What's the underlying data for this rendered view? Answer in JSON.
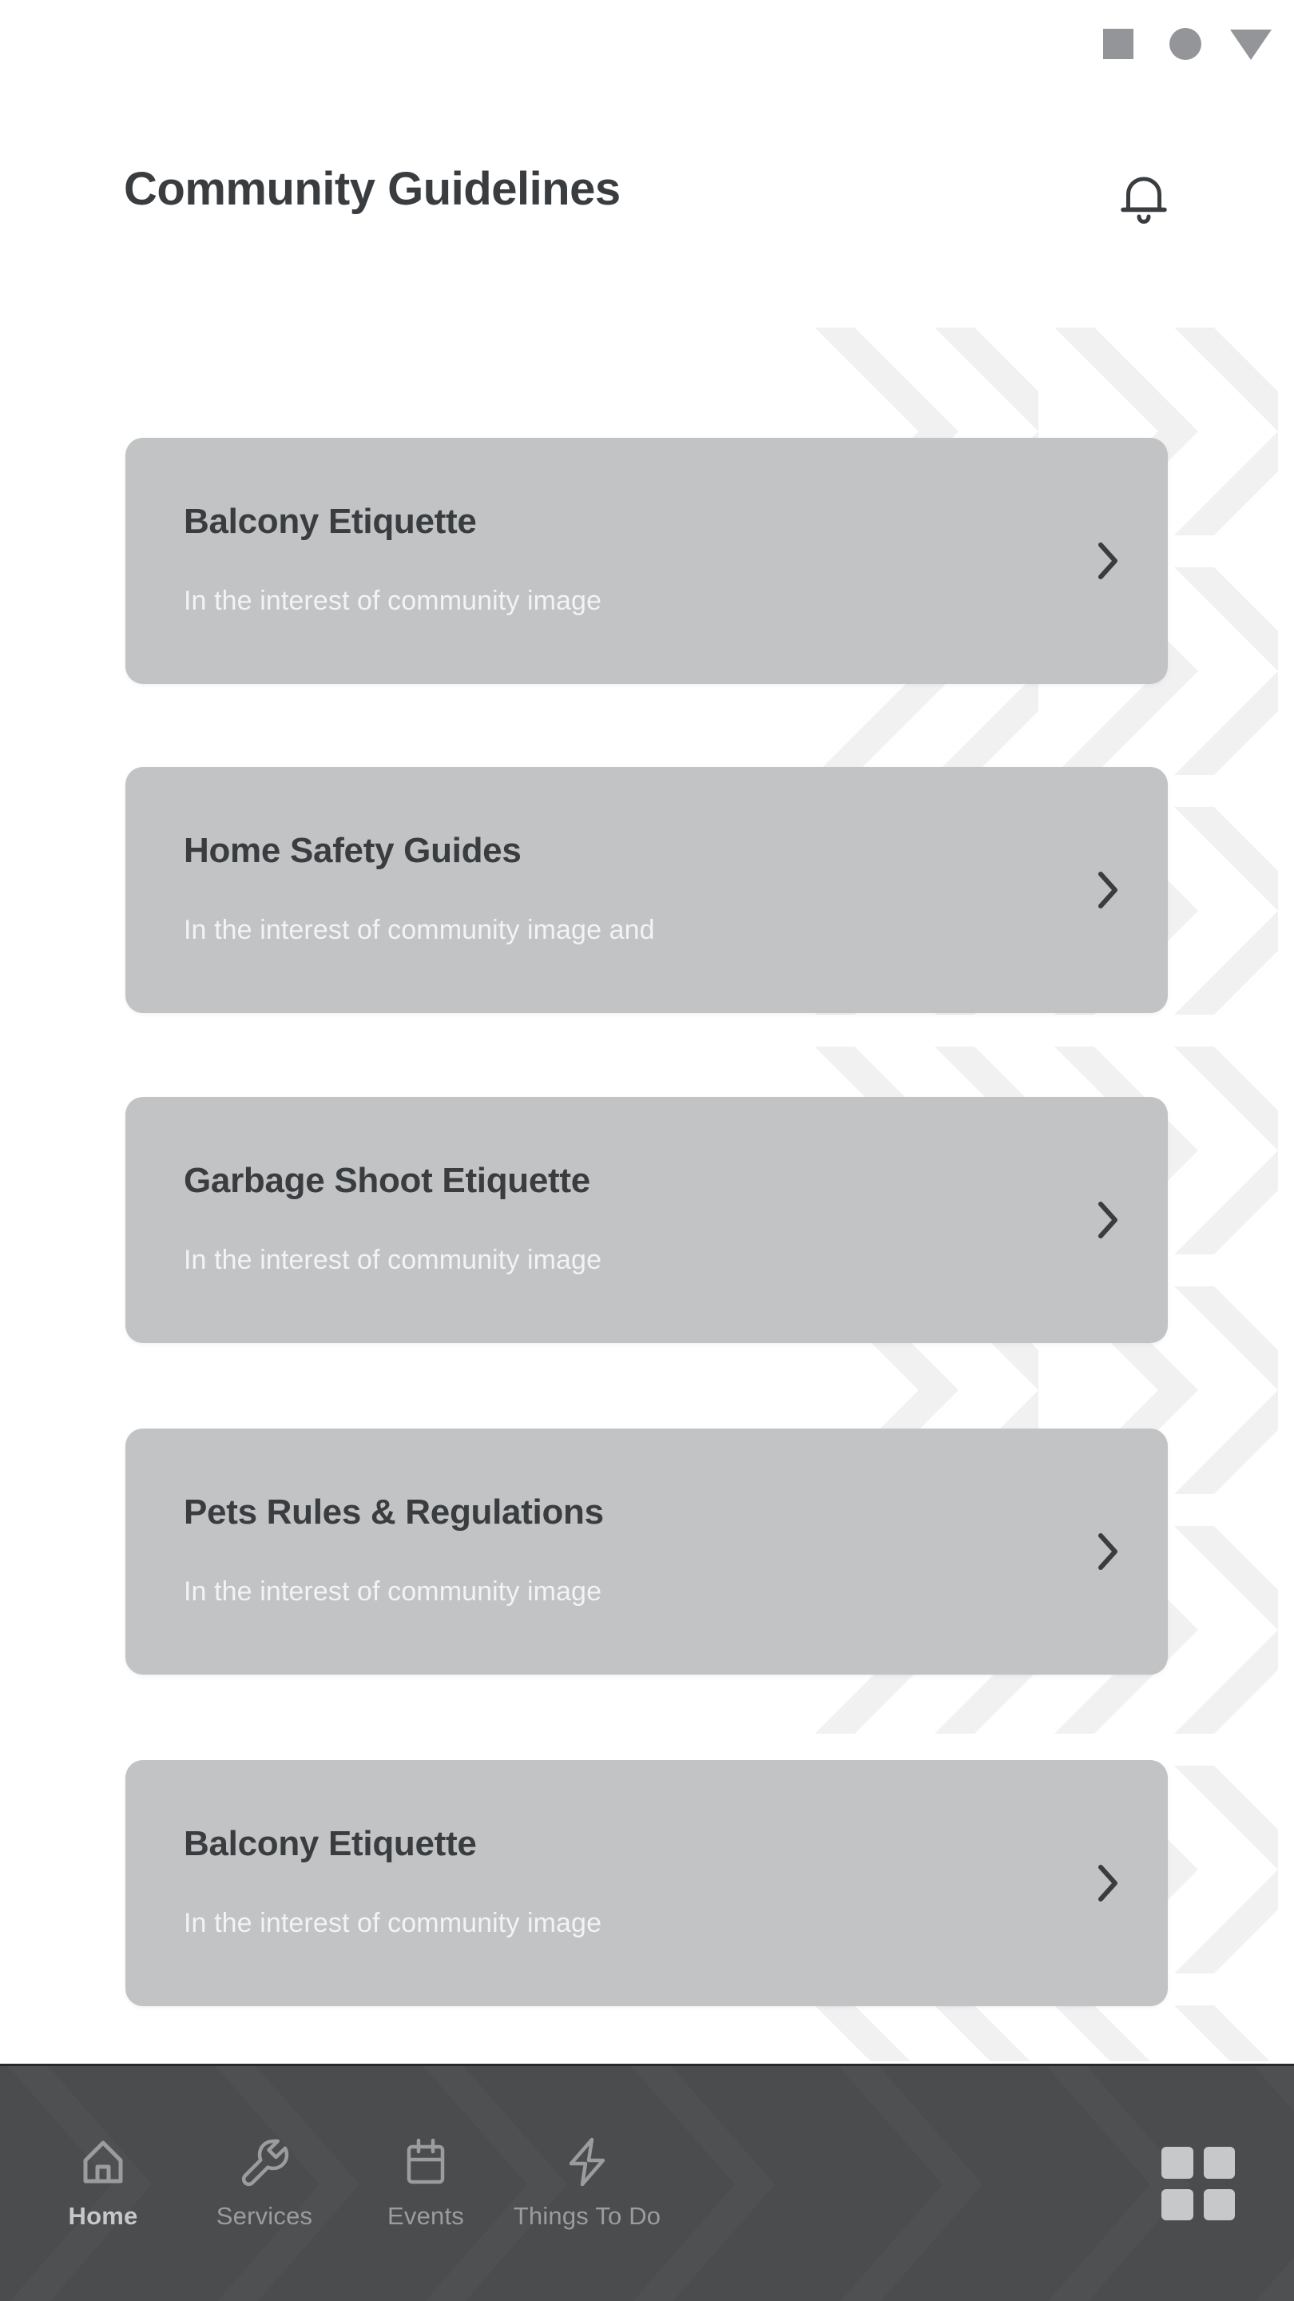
{
  "status_bar": {
    "icons": [
      {
        "name": "square-indicator-icon",
        "shape": "square"
      },
      {
        "name": "circle-indicator-icon",
        "shape": "circle"
      },
      {
        "name": "triangle-down-indicator-icon",
        "shape": "triangle-down"
      }
    ],
    "color": "#939598"
  },
  "header": {
    "title": "Community Guidelines",
    "notification_icon": "bell-icon",
    "title_color": "#3a3d40"
  },
  "theme": {
    "background": "#ffffff",
    "card_background": "#c2c3c4",
    "card_title_color": "#3a3d40",
    "card_subtitle_color": "#f2f3f4",
    "nav_background": "#4a4c4e",
    "nav_label_color": "#9a9c9e",
    "nav_active_color": "#c6c8ca"
  },
  "cards": [
    {
      "title": "Balcony Etiquette",
      "subtitle": "In the interest of community image",
      "chevron": "chevron-right-icon"
    },
    {
      "title": "Home Safety Guides",
      "subtitle": "In the interest of community image and",
      "chevron": "chevron-right-icon"
    },
    {
      "title": "Garbage Shoot Etiquette",
      "subtitle": "In the interest of community image",
      "chevron": "chevron-right-icon"
    },
    {
      "title": "Pets Rules & Regulations",
      "subtitle": "In the interest of community image",
      "chevron": "chevron-right-icon"
    },
    {
      "title": "Balcony Etiquette",
      "subtitle": "In the interest of community image",
      "chevron": "chevron-right-icon"
    }
  ],
  "bottom_nav": {
    "items": [
      {
        "label": "Home",
        "icon": "home-icon",
        "active": true
      },
      {
        "label": "Services",
        "icon": "wrench-icon",
        "active": false
      },
      {
        "label": "Events",
        "icon": "calendar-icon",
        "active": false
      },
      {
        "label": "Things To Do",
        "icon": "lightning-icon",
        "active": false
      }
    ],
    "grid_button": {
      "icon": "grid-menu-icon",
      "cells": 4
    }
  }
}
